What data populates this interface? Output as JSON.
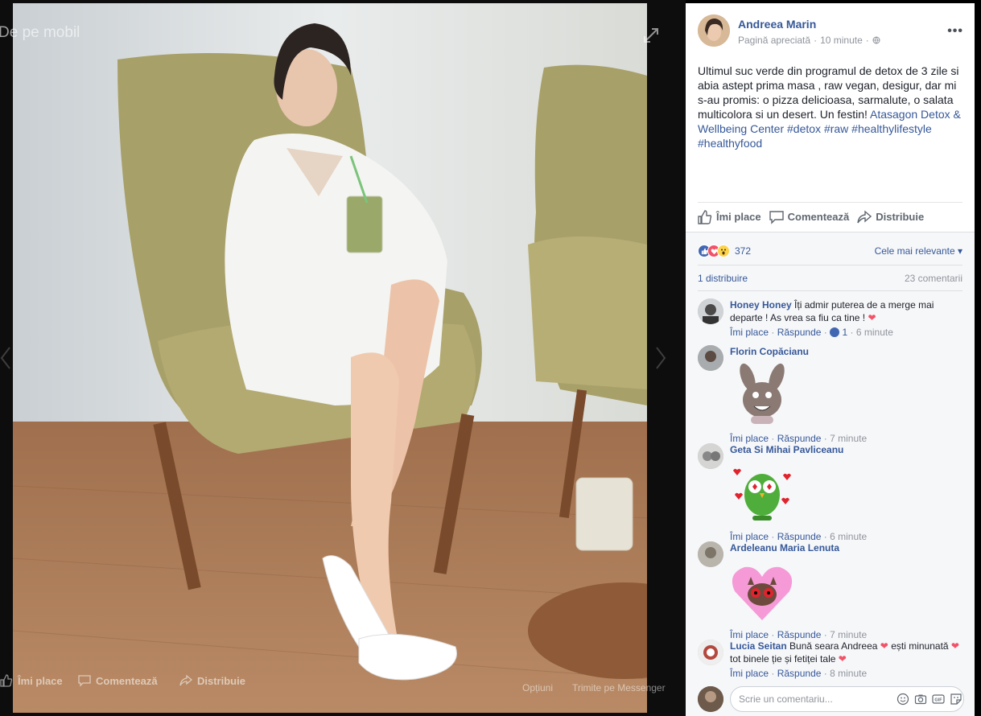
{
  "photo_overlay": {
    "mobile_label": "De pe mobil",
    "like_label": "Îmi place",
    "comment_label": "Comentează",
    "share_label": "Distribuie",
    "options_label": "Opțiuni",
    "messenger_label": "Trimite pe Messenger"
  },
  "post": {
    "author": "Andreea Marin",
    "meta_page": "Pagină apreciată",
    "meta_sep": "·",
    "meta_time": "10 minute",
    "meta_sep2": "·",
    "more": "•••",
    "text_plain": "Ultimul suc verde din programul de detox de 3 zile si abia astept prima masa , raw vegan, desigur, dar mi s-au promis: o pizza delicioasa, sarmalute, o salata multicolora si un desert. Un festin! ",
    "text_links": "Atasagon Detox & Wellbeing Center #detox #raw #healthylifestyle #healthyfood"
  },
  "actions": {
    "like": "Îmi place",
    "comment": "Comentează",
    "share": "Distribuie"
  },
  "feedback": {
    "reaction_count": "372",
    "sort": "Cele mai relevante ▾",
    "shares": "1 distribuire",
    "comments": "23 comentarii"
  },
  "comments": [
    {
      "name": "Honey Honey",
      "text": "Îți admir puterea de a merge mai departe ! As vrea sa fiu ca tine !",
      "like": "Îmi place",
      "sep": "·",
      "reply": "Răspunde",
      "sep2": "·",
      "likes": "1",
      "sep3": "·",
      "time": "6 minute"
    },
    {
      "name": "Florin Copăcianu",
      "like": "Îmi place",
      "sep": "·",
      "reply": "Răspunde",
      "sep2": "·",
      "time": "7 minute"
    },
    {
      "name": "Geta Si Mihai Pavliceanu",
      "like": "Îmi place",
      "sep": "·",
      "reply": "Răspunde",
      "sep2": "·",
      "time": "6 minute"
    },
    {
      "name": "Ardeleanu Maria Lenuta",
      "like": "Îmi place",
      "sep": "·",
      "reply": "Răspunde",
      "sep2": "·",
      "time": "7 minute"
    },
    {
      "name": "Lucia Seitan",
      "text1": "Bună seara Andreea",
      "text2": "ești minunată",
      "text3": "tot binele ție și fetiței tale",
      "like": "Îmi place",
      "sep": "·",
      "reply": "Răspunde",
      "sep2": "·",
      "time": "8 minute"
    }
  ],
  "composer": {
    "placeholder": "Scrie un comentariu..."
  },
  "colors": {
    "link": "#365899",
    "meta": "#90949c",
    "heart": "#f25268",
    "like_blue": "#4267b2"
  }
}
